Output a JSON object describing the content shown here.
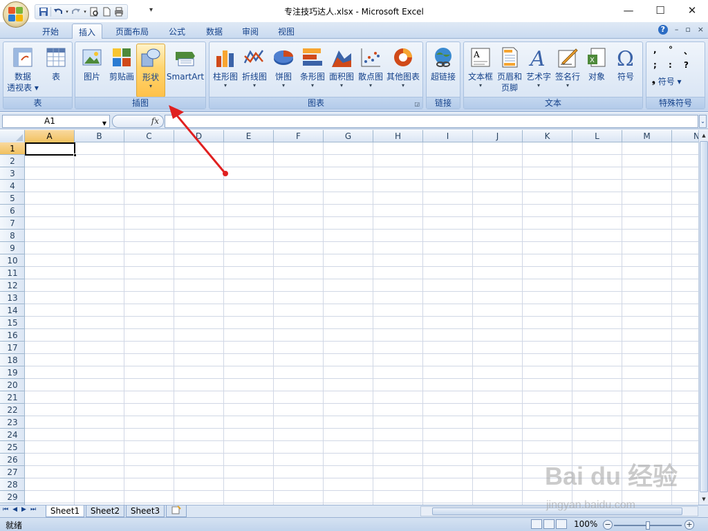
{
  "window": {
    "title": "专注技巧达人.xlsx - Microsoft Excel",
    "minimize": "—",
    "maximize": "☐",
    "close": "✕"
  },
  "quick_access": {
    "save_icon": "save-icon",
    "undo_icon": "undo-icon",
    "redo_icon": "redo-icon",
    "print_preview_icon": "print-preview-icon",
    "new_icon": "new-document-icon",
    "print_icon": "print-icon",
    "more": "▾"
  },
  "tabs": [
    {
      "label": "开始"
    },
    {
      "label": "插入",
      "active": true
    },
    {
      "label": "页面布局"
    },
    {
      "label": "公式"
    },
    {
      "label": "数据"
    },
    {
      "label": "审阅"
    },
    {
      "label": "视图"
    }
  ],
  "ribbon_controls": {
    "help": "?",
    "minimize": "–",
    "restore": "▫",
    "close": "×"
  },
  "groups": {
    "tables": {
      "label": "表",
      "pivot": {
        "line1": "数据",
        "line2": "透视表 ▾"
      },
      "table": "表"
    },
    "illustrations": {
      "label": "插图",
      "picture": "图片",
      "clipart": "剪贴画",
      "shapes": "形状",
      "smartart": "SmartArt"
    },
    "charts": {
      "label": "图表",
      "column": "柱形图",
      "line": "折线图",
      "pie": "饼图",
      "bar": "条形图",
      "area": "面积图",
      "scatter": "散点图",
      "other": "其他图表"
    },
    "links": {
      "label": "链接",
      "hyperlink": "超链接"
    },
    "text": {
      "label": "文本",
      "textbox": "文本框",
      "header": {
        "line1": "页眉和",
        "line2": "页脚"
      },
      "wordart": "艺术字",
      "signature": "签名行",
      "object": "对象",
      "symbol": "符号"
    },
    "special": {
      "label": "特殊符号",
      "symbols": [
        ",",
        "°",
        "、",
        ";",
        ":",
        "?"
      ],
      "dropdown": "符号 ▾"
    }
  },
  "formula_bar": {
    "name_box": "A1",
    "fx": "fx",
    "value": ""
  },
  "columns": [
    "A",
    "B",
    "C",
    "D",
    "E",
    "F",
    "G",
    "H",
    "I",
    "J",
    "K",
    "L",
    "M",
    "N"
  ],
  "rows": [
    "1",
    "2",
    "3",
    "4",
    "5",
    "6",
    "7",
    "8",
    "9",
    "10",
    "11",
    "12",
    "13",
    "14",
    "15",
    "16",
    "17",
    "18",
    "19",
    "20",
    "21",
    "22",
    "23",
    "24",
    "25",
    "26",
    "27",
    "28",
    "29"
  ],
  "sheets": [
    {
      "label": "Sheet1",
      "active": true
    },
    {
      "label": "Sheet2"
    },
    {
      "label": "Sheet3"
    }
  ],
  "status": {
    "text": "就绪",
    "zoom": "100%"
  },
  "watermark": {
    "logo": "Bai du 经验",
    "url": "jingyan.baidu.com"
  },
  "accent": {
    "arrow": "#e02020",
    "highlight": "#ffc14a"
  }
}
